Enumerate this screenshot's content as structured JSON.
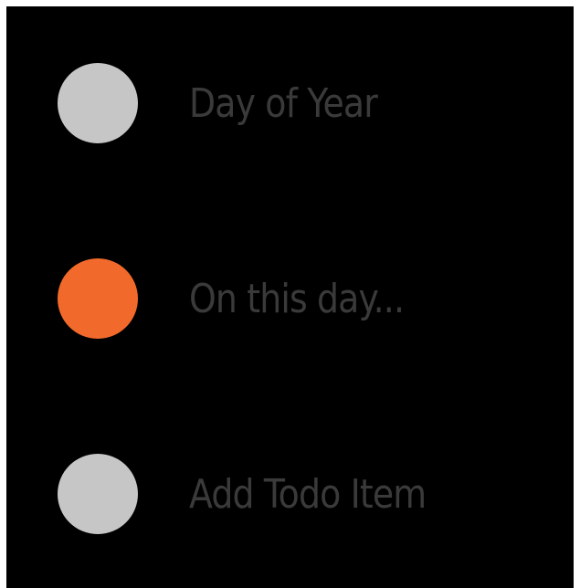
{
  "menu": {
    "items": [
      {
        "label": "Day of Year",
        "dot_color": "#c6c6c6",
        "selected": false
      },
      {
        "label": "On this day...",
        "dot_color": "#f26a2b",
        "selected": true
      },
      {
        "label": "Add Todo Item",
        "dot_color": "#c6c6c6",
        "selected": false
      }
    ]
  }
}
